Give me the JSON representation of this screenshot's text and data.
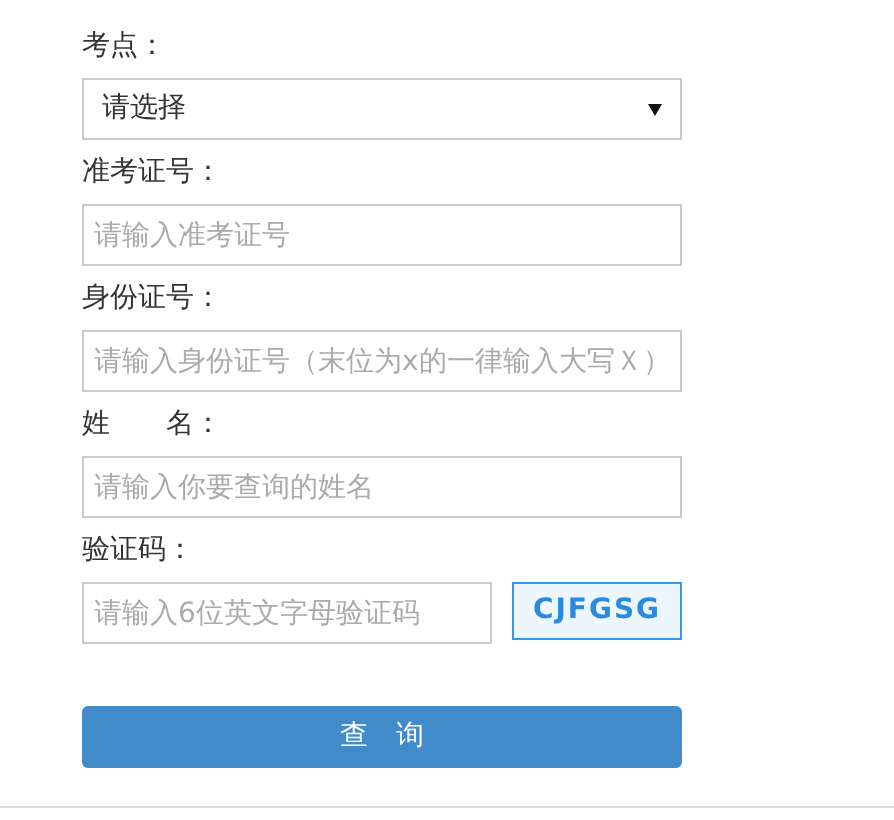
{
  "fields": [
    {
      "kind": "select",
      "label": "考点：",
      "value": "请选择"
    },
    {
      "kind": "input",
      "label": "准考证号：",
      "placeholder": "请输入准考证号"
    },
    {
      "kind": "input",
      "label": "身份证号：",
      "placeholder": "请输入身份证号（末位为x的一律输入大写Ｘ）"
    },
    {
      "kind": "input",
      "label": "姓　　名：",
      "placeholder": "请输入你要查询的姓名"
    },
    {
      "kind": "captcha",
      "label": "验证码：",
      "placeholder": "请输入6位英文字母验证码",
      "code": "CJFGSG"
    }
  ],
  "submit": {
    "label": "查　询"
  }
}
